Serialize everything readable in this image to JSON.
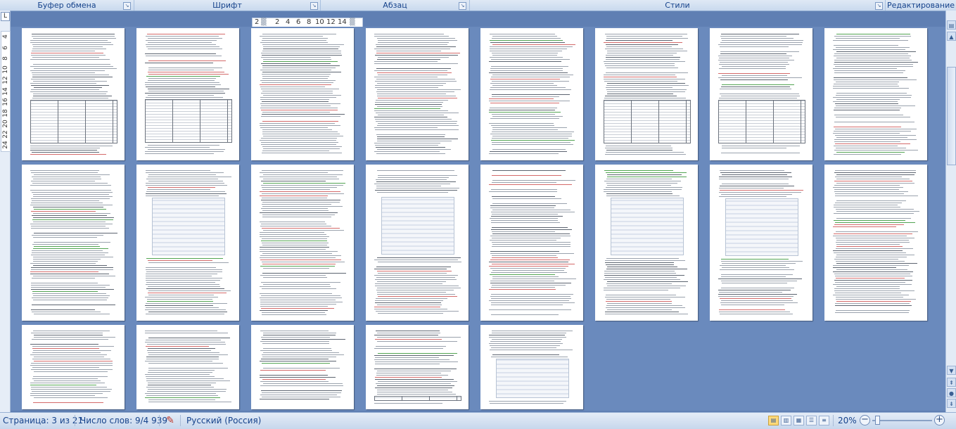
{
  "ribbon": {
    "groups": [
      {
        "label": "Буфер обмена"
      },
      {
        "label": "Шрифт"
      },
      {
        "label": "Абзац"
      },
      {
        "label": "Стили"
      },
      {
        "label": "Редактирование"
      }
    ]
  },
  "ruler": {
    "tab_selector": "L",
    "horizontal_marks": [
      "2",
      "2",
      "4",
      "6",
      "8",
      "10",
      "12",
      "14"
    ],
    "vertical_marks": [
      "4",
      "6",
      "8",
      "10",
      "12",
      "14",
      "16",
      "18",
      "20",
      "22",
      "24"
    ]
  },
  "document": {
    "page_count_shown": 21
  },
  "status": {
    "page": "Страница: 3 из 21",
    "words": "Число слов: 9/4 939",
    "language": "Русский (Россия)",
    "zoom": "20%"
  },
  "icons": {
    "proofing": "spellcheck-book-icon",
    "zoom_out": "minus-icon",
    "zoom_in": "plus-icon",
    "scroll_up": "arrow-up-icon",
    "scroll_down": "arrow-down-icon",
    "browse_prev": "double-arrow-up-icon",
    "browse_object": "circle-icon",
    "browse_next": "double-arrow-down-icon"
  },
  "colors": {
    "workspace": "#6a8abd",
    "accent": "#15428b",
    "page": "#ffffff"
  }
}
